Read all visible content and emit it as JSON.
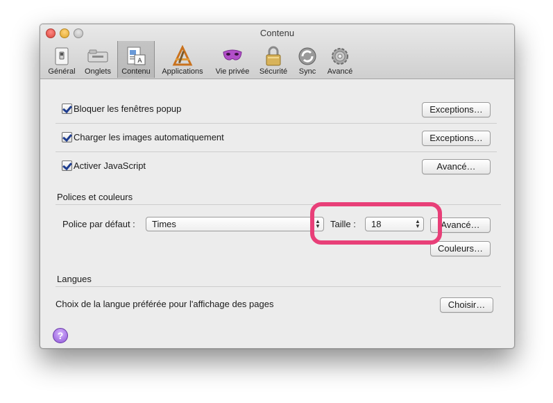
{
  "window": {
    "title": "Contenu"
  },
  "toolbar": {
    "items": [
      {
        "label": "Général",
        "icon": "general-switch-icon"
      },
      {
        "label": "Onglets",
        "icon": "tabs-icon"
      },
      {
        "label": "Contenu",
        "icon": "content-document-icon",
        "selected": true
      },
      {
        "label": "Applications",
        "icon": "applications-icon"
      },
      {
        "label": "Vie privée",
        "icon": "privacy-mask-icon"
      },
      {
        "label": "Sécurité",
        "icon": "security-padlock-icon"
      },
      {
        "label": "Sync",
        "icon": "sync-icon"
      },
      {
        "label": "Avancé",
        "icon": "advanced-gear-icon"
      }
    ]
  },
  "options": [
    {
      "label": "Bloquer les fenêtres popup",
      "checked": true,
      "button": "Exceptions…"
    },
    {
      "label": "Charger les images automatiquement",
      "checked": true,
      "button": "Exceptions…"
    },
    {
      "label": "Activer JavaScript",
      "checked": true,
      "button": "Avancé…"
    }
  ],
  "fonts": {
    "section_title": "Polices et couleurs",
    "default_font_label": "Police par défaut :",
    "default_font_value": "Times",
    "size_label": "Taille :",
    "size_value": "18",
    "advanced_button": "Avancé…",
    "colors_button": "Couleurs…"
  },
  "languages": {
    "section_title": "Langues",
    "description": "Choix de la langue préférée pour l'affichage des pages",
    "choose_button": "Choisir…"
  },
  "help": {
    "glyph": "?"
  },
  "colors": {
    "highlight": "#e83f78",
    "help_accent": "#8e55d6",
    "checkmark": "#1e3d8f"
  }
}
